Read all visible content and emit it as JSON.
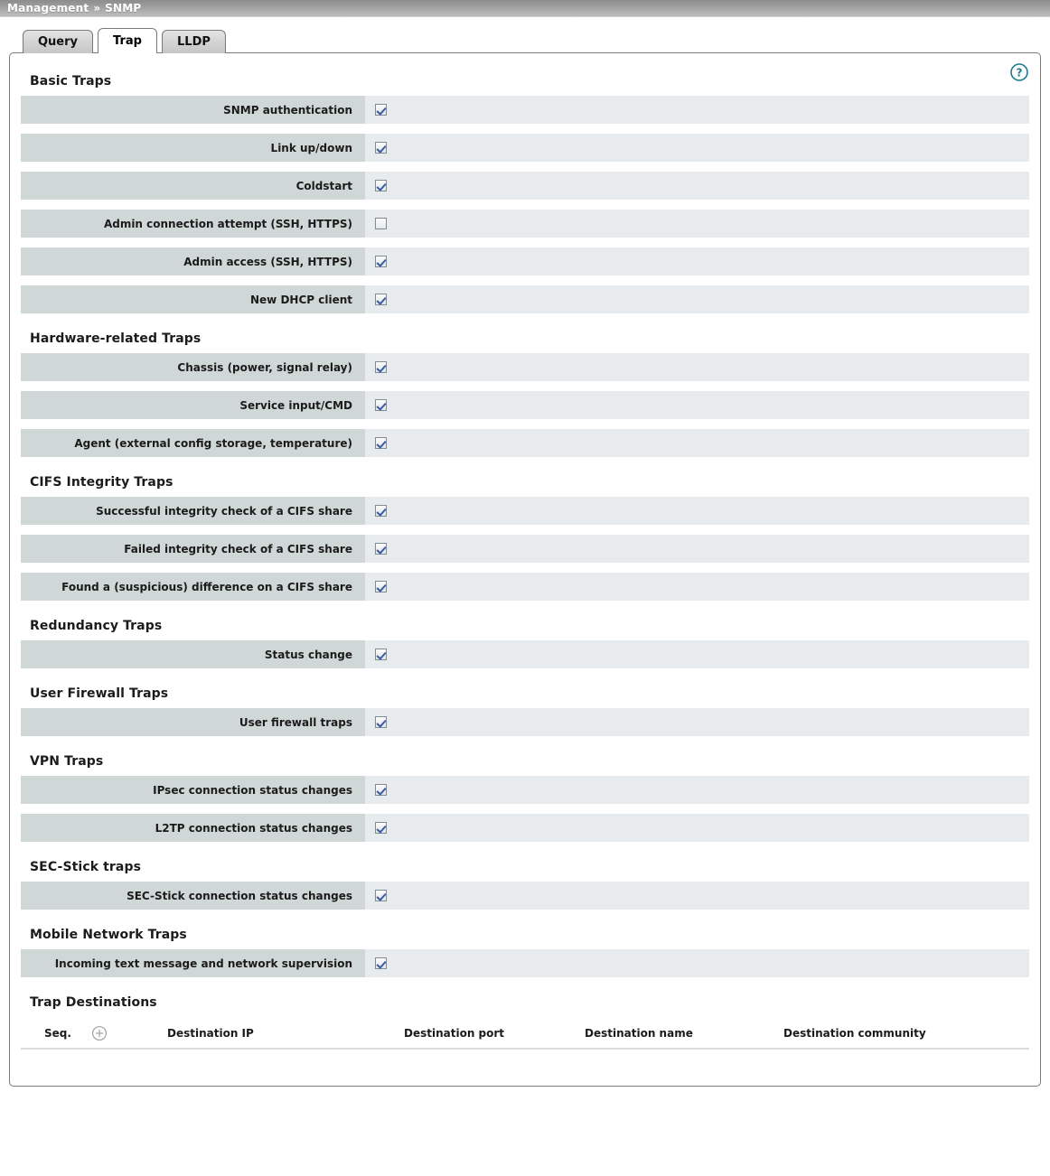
{
  "breadcrumb": {
    "root": "Management",
    "separator": "»",
    "current": "SNMP"
  },
  "tabs": [
    {
      "label": "Query",
      "active": false
    },
    {
      "label": "Trap",
      "active": true
    },
    {
      "label": "LLDP",
      "active": false
    }
  ],
  "help": {
    "icon": "help-question-icon",
    "color": "#1a7b8c"
  },
  "sections": [
    {
      "title": "Basic Traps",
      "rows": [
        {
          "label": "SNMP authentication",
          "checked": true
        },
        {
          "label": "Link up/down",
          "checked": true
        },
        {
          "label": "Coldstart",
          "checked": true
        },
        {
          "label": "Admin connection attempt (SSH, HTTPS)",
          "checked": false
        },
        {
          "label": "Admin access (SSH, HTTPS)",
          "checked": true
        },
        {
          "label": "New DHCP client",
          "checked": true
        }
      ]
    },
    {
      "title": "Hardware-related Traps",
      "rows": [
        {
          "label": "Chassis (power, signal relay)",
          "checked": true
        },
        {
          "label": "Service input/CMD",
          "checked": true
        },
        {
          "label": "Agent (external config storage, temperature)",
          "checked": true
        }
      ]
    },
    {
      "title": "CIFS Integrity Traps",
      "rows": [
        {
          "label": "Successful integrity check of a CIFS share",
          "checked": true
        },
        {
          "label": "Failed integrity check of a CIFS share",
          "checked": true
        },
        {
          "label": "Found a (suspicious) difference on a CIFS share",
          "checked": true
        }
      ]
    },
    {
      "title": "Redundancy Traps",
      "rows": [
        {
          "label": "Status change",
          "checked": true
        }
      ]
    },
    {
      "title": "User Firewall Traps",
      "rows": [
        {
          "label": "User firewall traps",
          "checked": true
        }
      ]
    },
    {
      "title": "VPN Traps",
      "rows": [
        {
          "label": "IPsec connection status changes",
          "checked": true
        },
        {
          "label": "L2TP connection status changes",
          "checked": true
        }
      ]
    },
    {
      "title": "SEC-Stick traps",
      "rows": [
        {
          "label": "SEC-Stick connection status changes",
          "checked": true
        }
      ]
    },
    {
      "title": "Mobile Network Traps",
      "rows": [
        {
          "label": "Incoming text message and network supervision",
          "checked": true
        }
      ]
    }
  ],
  "trap_destinations": {
    "title": "Trap Destinations",
    "add_icon": "plus-circle-icon",
    "columns": [
      {
        "key": "seq",
        "label": "Seq."
      },
      {
        "key": "ip",
        "label": "Destination IP"
      },
      {
        "key": "port",
        "label": "Destination port"
      },
      {
        "key": "name",
        "label": "Destination name"
      },
      {
        "key": "comm",
        "label": "Destination community"
      }
    ],
    "rows": []
  },
  "colors": {
    "label_cell": "#d0d8d7",
    "value_cell": "#e7ebed",
    "breadcrumb_start": "#8d8d8d",
    "breadcrumb_end": "#bcbcbc",
    "help_teal": "#1a7b8c"
  }
}
